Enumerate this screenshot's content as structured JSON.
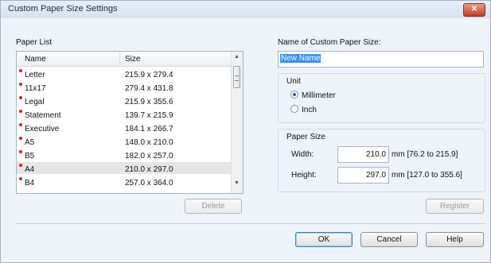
{
  "window": {
    "title": "Custom Paper Size Settings",
    "close_glyph": "✕"
  },
  "paper_list": {
    "label": "Paper List",
    "columns": {
      "name": "Name",
      "size": "Size"
    },
    "rows": [
      {
        "name": "Letter",
        "size": "215.9 x 279.4"
      },
      {
        "name": "11x17",
        "size": "279.4 x 431.8"
      },
      {
        "name": "Legal",
        "size": "215.9 x 355.6"
      },
      {
        "name": "Statement",
        "size": "139.7 x 215.9"
      },
      {
        "name": "Executive",
        "size": "184.1 x 266.7"
      },
      {
        "name": "A5",
        "size": "148.0 x 210.0"
      },
      {
        "name": "B5",
        "size": "182.0 x 257.0"
      },
      {
        "name": "A4",
        "size": "210.0 x 297.0"
      },
      {
        "name": "B4",
        "size": "257.0 x 364.0"
      }
    ],
    "scroll_up_glyph": "▲",
    "scroll_down_glyph": "▼"
  },
  "delete_button": "Delete",
  "name_field": {
    "label": "Name of Custom Paper Size:",
    "value": "New Name"
  },
  "unit": {
    "label": "Unit",
    "millimeter": "Millimeter",
    "inch": "Inch",
    "selected": "Millimeter"
  },
  "paper_size": {
    "label": "Paper Size",
    "width_label": "Width:",
    "width_value": "210.0",
    "width_range": "mm [76.2 to 215.9]",
    "height_label": "Height:",
    "height_value": "297.0",
    "height_range": "mm [127.0 to 355.6]"
  },
  "register_button": "Register",
  "ok_button": "OK",
  "cancel_button": "Cancel",
  "help_button": "Help",
  "colors": {
    "accent": "#3390ff",
    "required_marker": "#d21f1f",
    "close_button": "#c43b23"
  }
}
